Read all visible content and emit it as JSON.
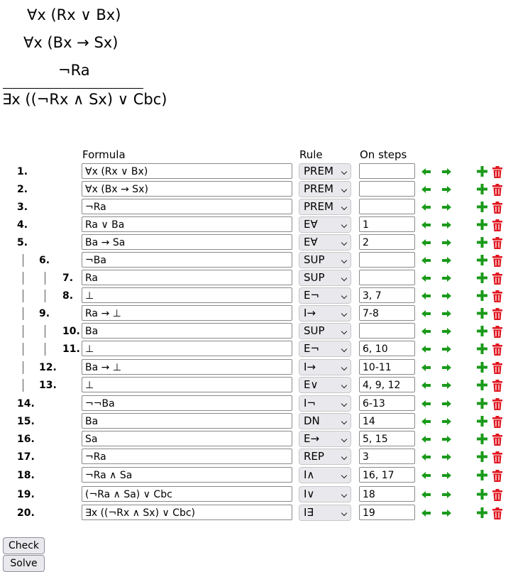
{
  "argument": {
    "premises": [
      "∀x (Rx ∨ Bx)",
      "∀x (Bx → Sx)",
      "¬Ra"
    ],
    "conclusion": "∃x ((¬Rx ∧ Sx) ∨ Cbc)"
  },
  "table": {
    "headers": {
      "formula": "Formula",
      "rule": "Rule",
      "steps": "On steps"
    }
  },
  "rows": [
    {
      "num": "1.",
      "depth": 0,
      "formula": "∀x (Rx ∨ Bx)",
      "rule": "PREM",
      "steps": ""
    },
    {
      "num": "2.",
      "depth": 0,
      "formula": "∀x (Bx → Sx)",
      "rule": "PREM",
      "steps": ""
    },
    {
      "num": "3.",
      "depth": 0,
      "formula": "¬Ra",
      "rule": "PREM",
      "steps": ""
    },
    {
      "num": "4.",
      "depth": 0,
      "formula": "Ra ∨ Ba",
      "rule": "E∀",
      "steps": "1"
    },
    {
      "num": "5.",
      "depth": 0,
      "formula": "Ba → Sa",
      "rule": "E∀",
      "steps": "2"
    },
    {
      "num": "6.",
      "depth": 1,
      "formula": "¬Ba",
      "rule": "SUP",
      "steps": ""
    },
    {
      "num": "7.",
      "depth": 2,
      "formula": "Ra",
      "rule": "SUP",
      "steps": ""
    },
    {
      "num": "8.",
      "depth": 2,
      "formula": "⊥",
      "rule": "E¬",
      "steps": "3, 7"
    },
    {
      "num": "9.",
      "depth": 1,
      "formula": "Ra → ⊥",
      "rule": "I→",
      "steps": "7-8"
    },
    {
      "num": "10.",
      "depth": 2,
      "formula": "Ba",
      "rule": "SUP",
      "steps": ""
    },
    {
      "num": "11.",
      "depth": 2,
      "formula": "⊥",
      "rule": "E¬",
      "steps": "6, 10"
    },
    {
      "num": "12.",
      "depth": 1,
      "formula": "Ba → ⊥",
      "rule": "I→",
      "steps": "10-11"
    },
    {
      "num": "13.",
      "depth": 1,
      "formula": "⊥",
      "rule": "E∨",
      "steps": "4, 9, 12"
    },
    {
      "num": "14.",
      "depth": 0,
      "formula": "¬¬Ba",
      "rule": "I¬",
      "steps": "6-13"
    },
    {
      "num": "15.",
      "depth": 0,
      "formula": "Ba",
      "rule": "DN",
      "steps": "14"
    },
    {
      "num": "16.",
      "depth": 0,
      "formula": "Sa",
      "rule": "E→",
      "steps": "5, 15"
    },
    {
      "num": "17.",
      "depth": 0,
      "formula": "¬Ra",
      "rule": "REP",
      "steps": "3"
    },
    {
      "num": "18.",
      "depth": 0,
      "formula": "¬Ra ∧ Sa",
      "rule": "I∧",
      "steps": "16, 17"
    },
    {
      "num": "19.",
      "depth": 0,
      "formula": "(¬Ra ∧ Sa) ∨ Cbc",
      "rule": "I∨",
      "steps": "18"
    },
    {
      "num": "20.",
      "depth": 0,
      "formula": "∃x ((¬Rx ∧ Sx) ∨ Cbc)",
      "rule": "I∃",
      "steps": "19"
    }
  ],
  "icons": {
    "outdent": "arrow-left-icon",
    "indent": "arrow-right-icon",
    "add": "plus-icon",
    "delete": "trash-icon",
    "icon_color": "#1a9a1a",
    "delete_color": "#e0141e"
  },
  "buttons": {
    "check": "Check",
    "solve": "Solve"
  }
}
